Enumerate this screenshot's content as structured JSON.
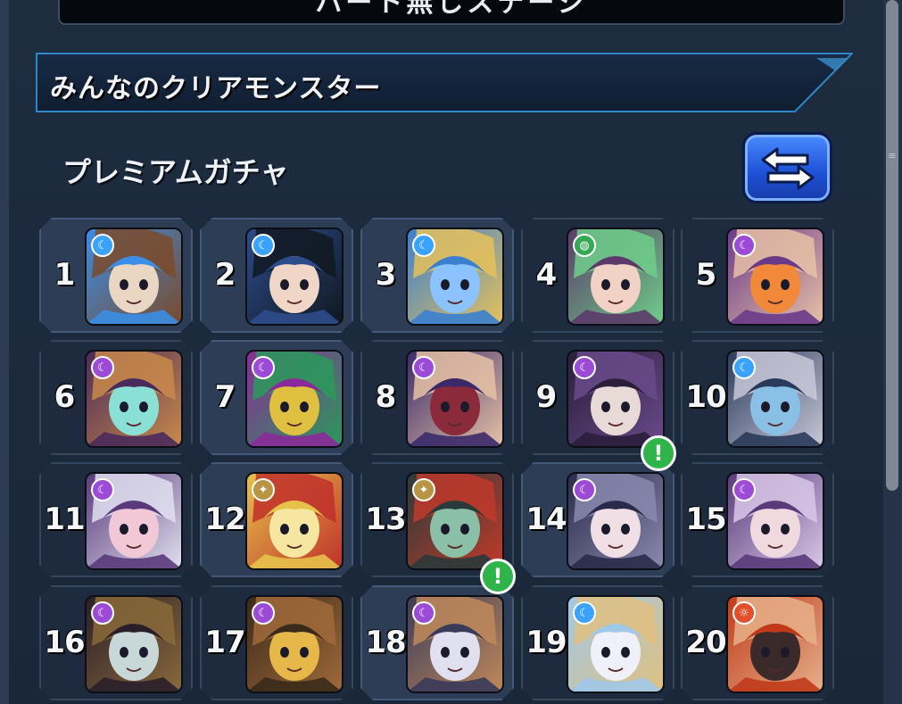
{
  "top_bar": {
    "title": "ハート無しステージ"
  },
  "section": {
    "title": "みんなのクリアモンスター"
  },
  "gacha": {
    "label": "プレミアムガチャ",
    "switch_icon": "swap-arrows-icon"
  },
  "colors": {
    "light": "#3aa2ff",
    "dark": "#9c4bd6",
    "wood": "#34a853",
    "fire": "#e0502a",
    "neutral": "#b89445",
    "alert": "#2fb44a"
  },
  "ranking": [
    {
      "rank": "1",
      "element": "light",
      "badge": "☾",
      "palette": [
        "#3a8ee6",
        "#e9d7c3",
        "#7b4a2a"
      ],
      "highlighted": true,
      "alert": false
    },
    {
      "rank": "2",
      "element": "light",
      "badge": "☾",
      "palette": [
        "#2d4c8c",
        "#f0d6c6",
        "#101820"
      ],
      "highlighted": true,
      "alert": false
    },
    {
      "rank": "3",
      "element": "light",
      "badge": "☾",
      "palette": [
        "#3a7fd0",
        "#8ac3ff",
        "#e6c15a"
      ],
      "highlighted": true,
      "alert": false
    },
    {
      "rank": "4",
      "element": "wood",
      "badge": "◍",
      "palette": [
        "#5b3a6a",
        "#f1d2c4",
        "#6fcf8a"
      ],
      "highlighted": false,
      "alert": false
    },
    {
      "rank": "5",
      "element": "dark",
      "badge": "☾",
      "palette": [
        "#6a3a8a",
        "#f08a3a",
        "#e8c1a6"
      ],
      "highlighted": false,
      "alert": false
    },
    {
      "rank": "6",
      "element": "dark",
      "badge": "☾",
      "palette": [
        "#4a2a5a",
        "#8be0d6",
        "#c98a4a"
      ],
      "highlighted": false,
      "alert": false
    },
    {
      "rank": "7",
      "element": "dark",
      "badge": "☾",
      "palette": [
        "#8a2a9a",
        "#e0c040",
        "#2a9a5a"
      ],
      "highlighted": true,
      "alert": false
    },
    {
      "rank": "8",
      "element": "dark",
      "badge": "☾",
      "palette": [
        "#3a2a6a",
        "#8a2a3a",
        "#e6c2a6"
      ],
      "highlighted": false,
      "alert": false
    },
    {
      "rank": "9",
      "element": "dark",
      "badge": "☾",
      "palette": [
        "#2a1e3a",
        "#e8dad6",
        "#6a4a8a"
      ],
      "highlighted": false,
      "alert": false
    },
    {
      "rank": "10",
      "element": "light",
      "badge": "☾",
      "palette": [
        "#2a3a5a",
        "#8ac0e6",
        "#c8c8d8"
      ],
      "highlighted": false,
      "alert": false
    },
    {
      "rank": "11",
      "element": "dark",
      "badge": "☾",
      "palette": [
        "#5a3a7a",
        "#f2c8d6",
        "#e0e0f0"
      ],
      "highlighted": false,
      "alert": false
    },
    {
      "rank": "12",
      "element": "neutral",
      "badge": "✦",
      "palette": [
        "#e6c24a",
        "#f5e6a0",
        "#c0302a"
      ],
      "highlighted": true,
      "alert": false
    },
    {
      "rank": "13",
      "element": "neutral",
      "badge": "✦",
      "palette": [
        "#2a3a3a",
        "#8ac0a8",
        "#c03a2a"
      ],
      "highlighted": false,
      "alert": false
    },
    {
      "rank": "14",
      "element": "dark",
      "badge": "☾",
      "palette": [
        "#2a2a4a",
        "#f0e0e6",
        "#8a8ab0"
      ],
      "highlighted": true,
      "alert": true
    },
    {
      "rank": "15",
      "element": "dark",
      "badge": "☾",
      "palette": [
        "#5a3a7a",
        "#f0dae0",
        "#d8c8e8"
      ],
      "highlighted": false,
      "alert": false
    },
    {
      "rank": "16",
      "element": "dark",
      "badge": "☾",
      "palette": [
        "#2a1e2a",
        "#c8d8d8",
        "#8a6a3a"
      ],
      "highlighted": false,
      "alert": false
    },
    {
      "rank": "17",
      "element": "dark",
      "badge": "☾",
      "palette": [
        "#3a2a1a",
        "#e6b84a",
        "#a06a3a"
      ],
      "highlighted": false,
      "alert": false
    },
    {
      "rank": "18",
      "element": "dark",
      "badge": "☾",
      "palette": [
        "#3a3a5a",
        "#e0e0f0",
        "#c08a5a"
      ],
      "highlighted": true,
      "alert": true
    },
    {
      "rank": "19",
      "element": "light",
      "badge": "☾",
      "palette": [
        "#a0c8e8",
        "#f0f0f8",
        "#e0c080"
      ],
      "highlighted": false,
      "alert": false
    },
    {
      "rank": "20",
      "element": "fire",
      "badge": "☼",
      "palette": [
        "#c03a1a",
        "#3a2a2a",
        "#e6b08a"
      ],
      "highlighted": false,
      "alert": false
    }
  ]
}
